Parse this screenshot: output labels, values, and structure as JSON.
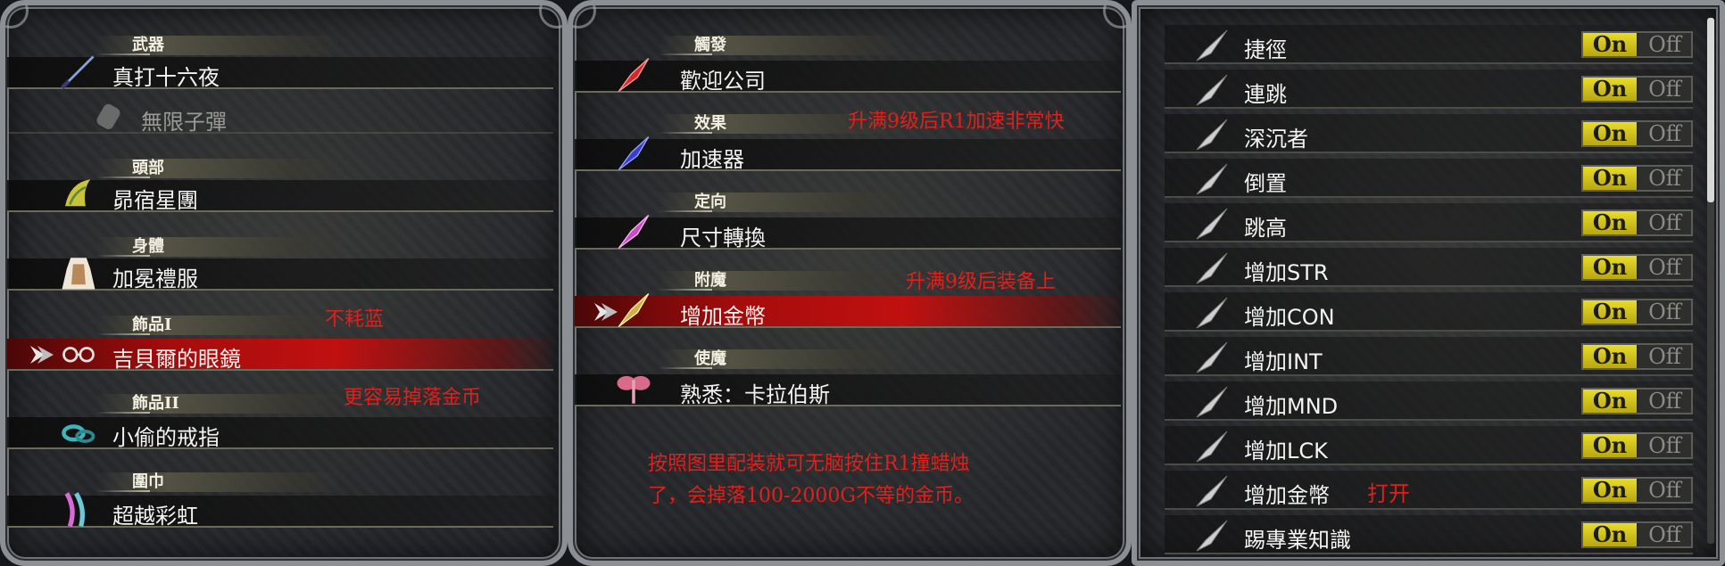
{
  "left_panel": {
    "rows": [
      {
        "category": "武器",
        "label": "真打十六夜",
        "icon": "katana-icon"
      },
      {
        "category": "",
        "label": "無限子彈",
        "icon": "bullet-canister-icon",
        "dimmed": true
      },
      {
        "category": "頭部",
        "label": "昴宿星團",
        "icon": "winged-helm-icon"
      },
      {
        "category": "身體",
        "label": "加冕禮服",
        "icon": "dress-icon"
      },
      {
        "category": "飾品I",
        "label": "吉貝爾的眼鏡",
        "icon": "glasses-icon",
        "selected": true
      },
      {
        "category": "飾品II",
        "label": "小偷的戒指",
        "icon": "ring-icon"
      },
      {
        "category": "圍巾",
        "label": "超越彩虹",
        "icon": "rainbow-scarf-icon"
      }
    ],
    "notes": [
      "不耗蓝",
      "更容易掉落金币"
    ]
  },
  "mid_panel": {
    "rows": [
      {
        "category": "觸發",
        "label": "歡迎公司",
        "icon": "red-shard-icon",
        "color": "#d22a2a"
      },
      {
        "category": "效果",
        "label": "加速器",
        "icon": "blue-shard-icon",
        "color": "#3840c8"
      },
      {
        "category": "定向",
        "label": "尺寸轉換",
        "icon": "pink-shard-icon",
        "color": "#c64fbf"
      },
      {
        "category": "附魔",
        "label": "增加金幣",
        "icon": "gold-shard-icon",
        "color": "#c9b24a",
        "selected": true
      },
      {
        "category": "使魔",
        "label": "熟悉：卡拉伯斯",
        "icon": "fairy-icon"
      }
    ],
    "notes": [
      "升满9级后R1加速非常快",
      "升满9级后装备上",
      "按照图里配装就可无脑按住R1撞蜡烛",
      "了，会掉落100-2000G不等的金币。"
    ]
  },
  "right_panel": {
    "options": [
      {
        "label": "捷徑",
        "on": "On",
        "off": "Off"
      },
      {
        "label": "連跳",
        "on": "On",
        "off": "Off"
      },
      {
        "label": "深沉者",
        "on": "On",
        "off": "Off"
      },
      {
        "label": "倒置",
        "on": "On",
        "off": "Off"
      },
      {
        "label": "跳高",
        "on": "On",
        "off": "Off"
      },
      {
        "label": "增加STR",
        "on": "On",
        "off": "Off"
      },
      {
        "label": "增加CON",
        "on": "On",
        "off": "Off"
      },
      {
        "label": "增加INT",
        "on": "On",
        "off": "Off"
      },
      {
        "label": "增加MND",
        "on": "On",
        "off": "Off"
      },
      {
        "label": "增加LCK",
        "on": "On",
        "off": "Off"
      },
      {
        "label": "增加金幣",
        "on": "On",
        "off": "Off",
        "note": "打开"
      },
      {
        "label": "踢專業知識",
        "on": "On",
        "off": "Off"
      }
    ],
    "scroll_fraction": 0.35
  },
  "colors": {
    "selected_row": "#c01010",
    "note_text": "#e0201c",
    "toggle_on": "#e9dc2a"
  }
}
